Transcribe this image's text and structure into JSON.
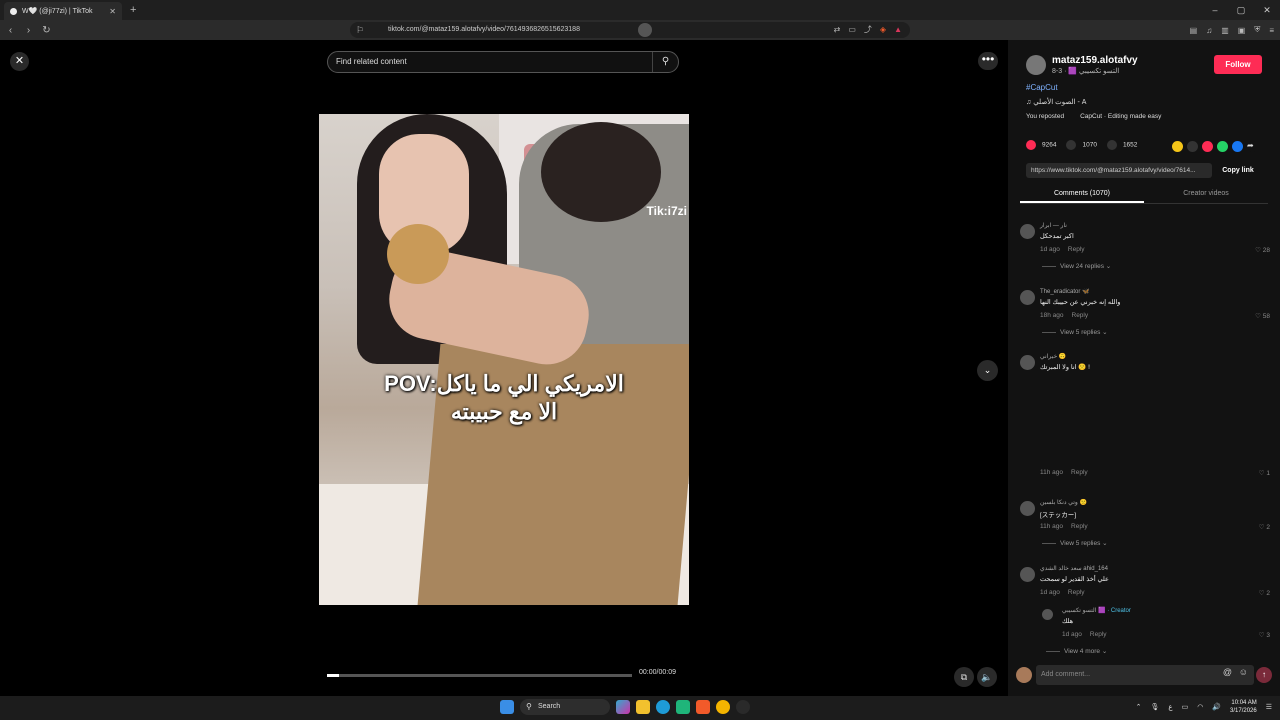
{
  "browser": {
    "tab_title": "W🤍 (@ji77zi) | TikTok",
    "url": "tiktok.com/@mataz159.alotafvy/video/7614936826515623188"
  },
  "video": {
    "search_placeholder": "Find related content",
    "watermark": "Tik:i7zi",
    "caption_line1": "POV:الامريكي الي ما ياكل",
    "caption_line2": "الا مع حبيبته",
    "time": "00:00/00:09",
    "progress": 0.04
  },
  "author": {
    "username": "mataz159.alotafvy",
    "nickname": "التسو تكسيبي 🟪 · 3-8",
    "follow": "Follow",
    "hashtag": "#CapCut",
    "music": "♫ الصوت الأصلي - A",
    "reposted": "You reposted",
    "capcut": "CapCut · Editing made easy"
  },
  "stats": {
    "likes": "9264",
    "comments": "1070",
    "saves": "1652"
  },
  "share": {
    "link": "https://www.tiktok.com/@mataz159.alotafvy/video/7614...",
    "copy": "Copy link"
  },
  "tabs": {
    "comments": "Comments (1070)",
    "creator": "Creator videos"
  },
  "comments": [
    {
      "user": "نار — ابرار",
      "text": "اكبر تمدحكل",
      "time": "1d ago",
      "reply": "Reply",
      "likes": "28",
      "view": "View 24 replies"
    },
    {
      "user": "The_eradicator 🦋",
      "text": "والله إنه خبرني عن حبيبك النها",
      "time": "18h ago",
      "reply": "Reply",
      "likes": "58",
      "view": "View 5 replies"
    },
    {
      "user": "خيراني 🙃",
      "text": "انا ولا المبرتك 🙁 !",
      "time": "11h ago",
      "reply": "Reply",
      "likes": "1",
      "view": ""
    },
    {
      "user": "وتي دنكا بلسين 🙁",
      "text": "[ステッカー]",
      "time": "11h ago",
      "reply": "Reply",
      "likes": "2",
      "view": "View 5 replies"
    },
    {
      "user": "سعد خالد الشدي ahid_164",
      "text": "علي أخذ القدير لو سمحت",
      "time": "1d ago",
      "reply": "Reply",
      "likes": "2",
      "view": ""
    }
  ],
  "reply": {
    "user": "التسو تكسيبي 🟪",
    "creator": "· Creator",
    "text": "هلك",
    "time": "1d ago",
    "reply": "Reply",
    "likes": "3",
    "view": "View 4 more"
  },
  "add_comment": {
    "placeholder": "Add comment..."
  },
  "taskbar": {
    "search": "Search",
    "time": "10:04 AM",
    "date": "3/17/2026"
  }
}
